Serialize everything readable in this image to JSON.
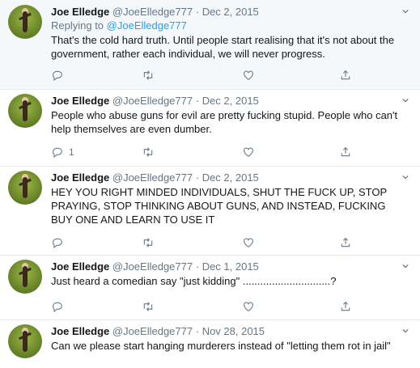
{
  "tweets": [
    {
      "name": "Joe Elledge",
      "handle": "@JoeElledge777",
      "date": "Dec 2, 2015",
      "reply_prefix": "Replying to ",
      "reply_to": "@JoeElledge777",
      "text": "That's the cold hard truth. Until people start realising that it's not about the government, rather each individual, we will never progress.",
      "reply_count": ""
    },
    {
      "name": "Joe Elledge",
      "handle": "@JoeElledge777",
      "date": "Dec 2, 2015",
      "text": "People who abuse guns for evil are pretty fucking stupid. People who can't help themselves are even dumber.",
      "reply_count": "1"
    },
    {
      "name": "Joe Elledge",
      "handle": "@JoeElledge777",
      "date": "Dec 2, 2015",
      "text": "HEY YOU RIGHT MINDED INDIVIDUALS, SHUT THE FUCK UP, STOP PRAYING, STOP THINKING ABOUT GUNS, AND INSTEAD, FUCKING BUY ONE AND LEARN TO USE IT",
      "reply_count": ""
    },
    {
      "name": "Joe Elledge",
      "handle": "@JoeElledge777",
      "date": "Dec 1, 2015",
      "text": "Just heard a comedian say \"just kidding\" ..............................?",
      "reply_count": ""
    },
    {
      "name": "Joe Elledge",
      "handle": "@JoeElledge777",
      "date": "Nov 28, 2015",
      "text": "Can we please start hanging murderers instead of \"letting them rot in jail\"",
      "reply_count": ""
    }
  ],
  "separator": "·",
  "icons": {
    "reply": "reply-icon",
    "retweet": "retweet-icon",
    "like": "like-icon",
    "share": "share-icon",
    "more": "chevron-down-icon"
  },
  "colors": {
    "name": "#14171a",
    "secondary": "#657786",
    "mention": "#1da1f2",
    "highlight_bg": "#f5f8fa",
    "divider": "#e6ecf0"
  }
}
